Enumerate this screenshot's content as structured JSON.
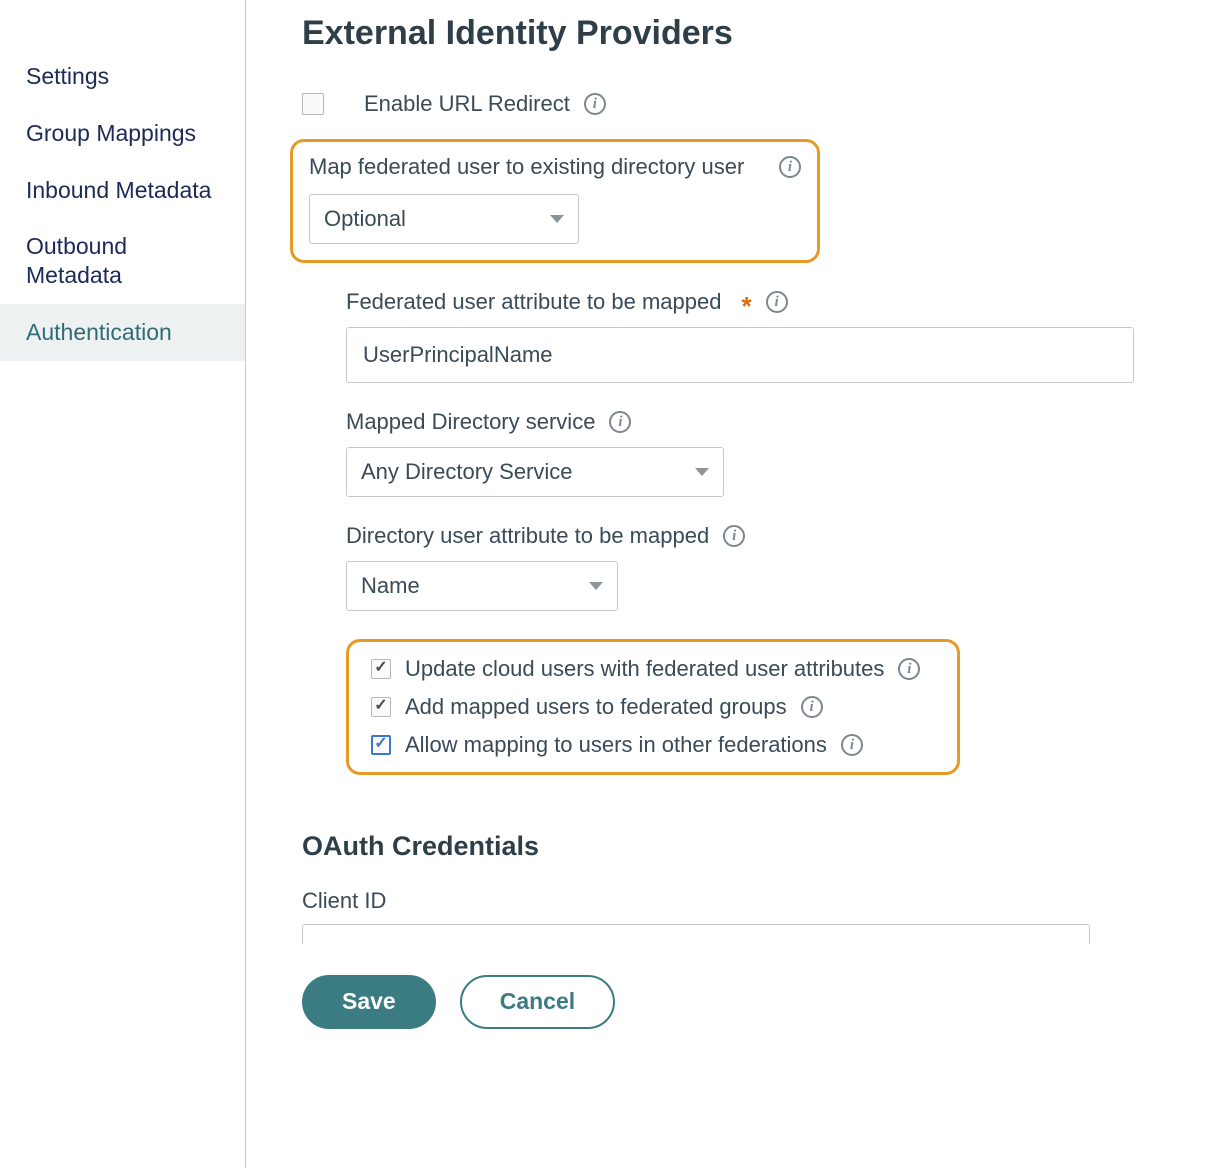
{
  "page": {
    "title": "External Identity Providers",
    "oauth_section_title": "OAuth Credentials",
    "client_id_label": "Client ID"
  },
  "sidebar": {
    "items": [
      {
        "label": "Settings"
      },
      {
        "label": "Group Mappings"
      },
      {
        "label": "Inbound Metadata"
      },
      {
        "label": "Outbound Metadata"
      },
      {
        "label": "Authentication"
      }
    ],
    "active_index": 4
  },
  "fields": {
    "enable_url_redirect": {
      "label": "Enable URL Redirect",
      "checked": false
    },
    "map_federated": {
      "label": "Map federated user to existing directory user",
      "value": "Optional"
    },
    "federated_attr": {
      "label": "Federated user attribute to be mapped",
      "required": true,
      "value": "UserPrincipalName"
    },
    "mapped_dir_service": {
      "label": "Mapped Directory service",
      "value": "Any Directory Service"
    },
    "directory_user_attr": {
      "label": "Directory user attribute to be mapped",
      "value": "Name"
    },
    "opts": [
      {
        "label": "Update cloud users with federated user attributes",
        "checked": true,
        "blue": false
      },
      {
        "label": "Add mapped users to federated groups",
        "checked": true,
        "blue": false
      },
      {
        "label": "Allow mapping to users in other federations",
        "checked": true,
        "blue": true
      }
    ]
  },
  "buttons": {
    "save": "Save",
    "cancel": "Cancel"
  }
}
